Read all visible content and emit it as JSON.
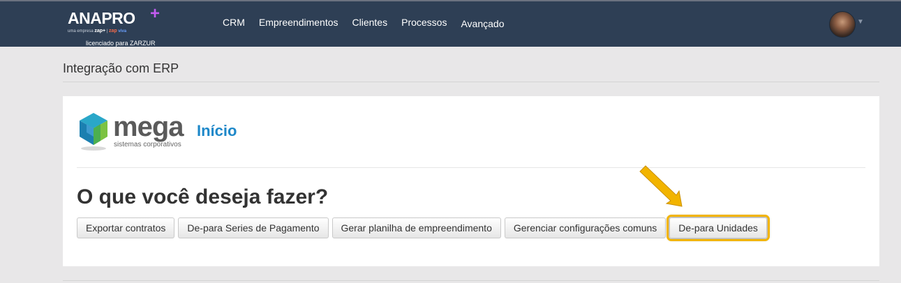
{
  "brand": {
    "name": "ANAPRO",
    "plus": "+",
    "tagline_prefix": "uma empresa",
    "tagline_zap_plus": "zap+",
    "tagline_zap": "zap",
    "tagline_viva": "viva",
    "licensed": "licenciado para ZARZUR"
  },
  "nav": {
    "items": [
      {
        "label": "CRM"
      },
      {
        "label": "Empreendimentos"
      },
      {
        "label": "Clientes"
      },
      {
        "label": "Processos"
      },
      {
        "label": "Avançado"
      }
    ]
  },
  "page": {
    "title": "Integração com ERP"
  },
  "card": {
    "logo_word": "mega",
    "logo_sub": "sistemas corporativos",
    "heading": "Início",
    "question": "O que você deseja fazer?",
    "buttons": [
      {
        "label": "Exportar contratos"
      },
      {
        "label": "De-para Series de Pagamento"
      },
      {
        "label": "Gerar planilha de empreendimento"
      },
      {
        "label": "Gerenciar configurações comuns"
      },
      {
        "label": "De-para Unidades"
      }
    ]
  },
  "colors": {
    "topbar": "#2e3f55",
    "accent_plus": "#c35cf0",
    "heading_blue": "#1e88c9",
    "highlight": "#f2b400"
  },
  "icons": {
    "avatar": "user-avatar",
    "caret": "chevron-down-icon",
    "arrow": "arrow-pointer-icon"
  }
}
